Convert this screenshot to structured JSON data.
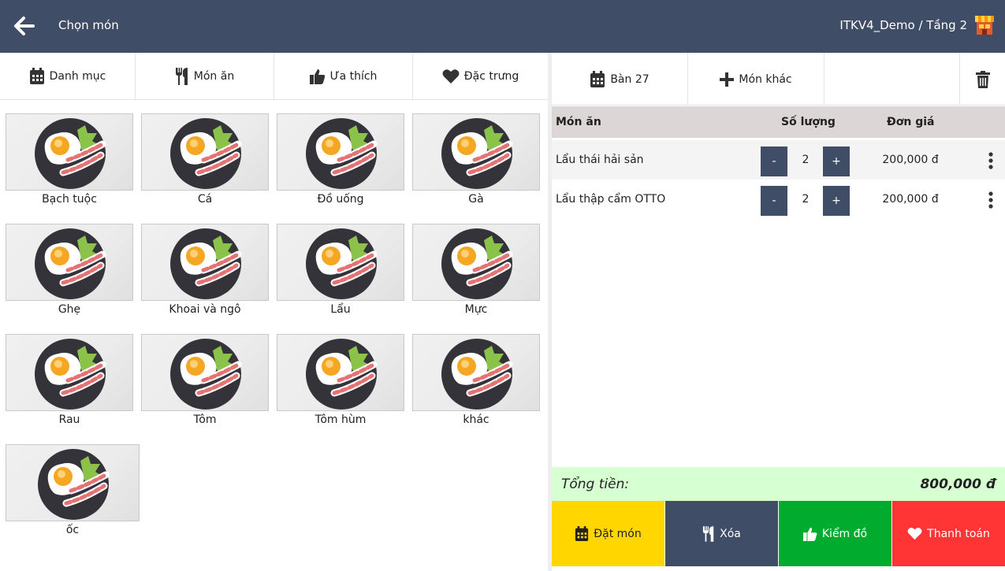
{
  "header": {
    "title": "Chọn món",
    "location": "ITKV4_Demo / Tầng 2",
    "back_icon": "arrow-left-icon",
    "store_icon": "store-icon"
  },
  "left_tabs": [
    {
      "label": "Danh mục",
      "icon": "calendar-icon"
    },
    {
      "label": "Món ăn",
      "icon": "cutlery-icon"
    },
    {
      "label": "Ưa thích",
      "icon": "thumbs-up-icon"
    },
    {
      "label": "Đặc trưng",
      "icon": "heart-icon"
    }
  ],
  "categories": [
    "Bạch tuộc",
    "Cá",
    "Đồ uống",
    "Gà",
    "Ghẹ",
    "Khoai và ngô",
    "Lẩu",
    "Mực",
    "Rau",
    "Tôm",
    "Tôm hùm",
    "khác",
    "ốc"
  ],
  "right_tabs": {
    "table_label": "Bàn 27",
    "other_label": "Món khác"
  },
  "order_table": {
    "headers": {
      "name": "Món ăn",
      "qty": "Số lượng",
      "price": "Đơn giá"
    },
    "minus_label": "-",
    "plus_label": "+",
    "rows": [
      {
        "name": "Lẩu thái hải sản",
        "qty": "2",
        "price": "200,000 đ"
      },
      {
        "name": "Lẩu thập cẩm OTTO",
        "qty": "2",
        "price": "200,000 đ"
      }
    ]
  },
  "total": {
    "label": "Tổng tiền:",
    "value": "800,000 đ"
  },
  "actions": [
    {
      "label": "Đặt món",
      "color": "#ffd600",
      "text_color": "#222222",
      "icon": "calendar-icon"
    },
    {
      "label": "Xóa",
      "color": "#3f4e66",
      "text_color": "#ffffff",
      "icon": "cutlery-icon"
    },
    {
      "label": "Kiểm đồ",
      "color": "#00ab2e",
      "text_color": "#ffffff",
      "icon": "thumbs-up-icon"
    },
    {
      "label": "Thanh toán",
      "color": "#ff3434",
      "text_color": "#ffffff",
      "icon": "heart-icon"
    }
  ],
  "colors": {
    "header_bg": "#3f4e66",
    "table_header_bg": "#dcd6d6",
    "total_bg": "#d6ffd2"
  }
}
